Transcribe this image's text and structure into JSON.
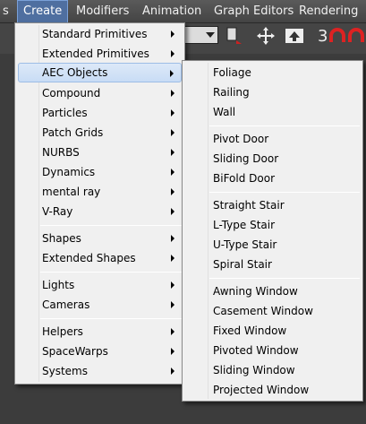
{
  "menubar": {
    "items": [
      {
        "label": "s"
      },
      {
        "label": "Create"
      },
      {
        "label": "Modifiers"
      },
      {
        "label": "Animation"
      },
      {
        "label": "Graph Editors"
      },
      {
        "label": "Rendering"
      }
    ]
  },
  "toolbar": {
    "snap_label": "3"
  },
  "create_menu": {
    "items": [
      "Standard Primitives",
      "Extended Primitives",
      "AEC Objects",
      "Compound",
      "Particles",
      "Patch Grids",
      "NURBS",
      "Dynamics",
      "mental ray",
      "V-Ray",
      "Shapes",
      "Extended Shapes",
      "Lights",
      "Cameras",
      "Helpers",
      "SpaceWarps",
      "Systems"
    ],
    "highlighted": "AEC Objects"
  },
  "aec_menu": {
    "items": [
      "Foliage",
      "Railing",
      "Wall",
      "Pivot Door",
      "Sliding Door",
      "BiFold Door",
      "Straight Stair",
      "L-Type Stair",
      "U-Type Stair",
      "Spiral Stair",
      "Awning Window",
      "Casement Window",
      "Fixed Window",
      "Pivoted Window",
      "Sliding Window",
      "Projected Window"
    ]
  },
  "colors": {
    "menu_bg": "#f0f0f0",
    "highlight": "#c8dcf5",
    "menubar_active": "#4f6fa0"
  }
}
